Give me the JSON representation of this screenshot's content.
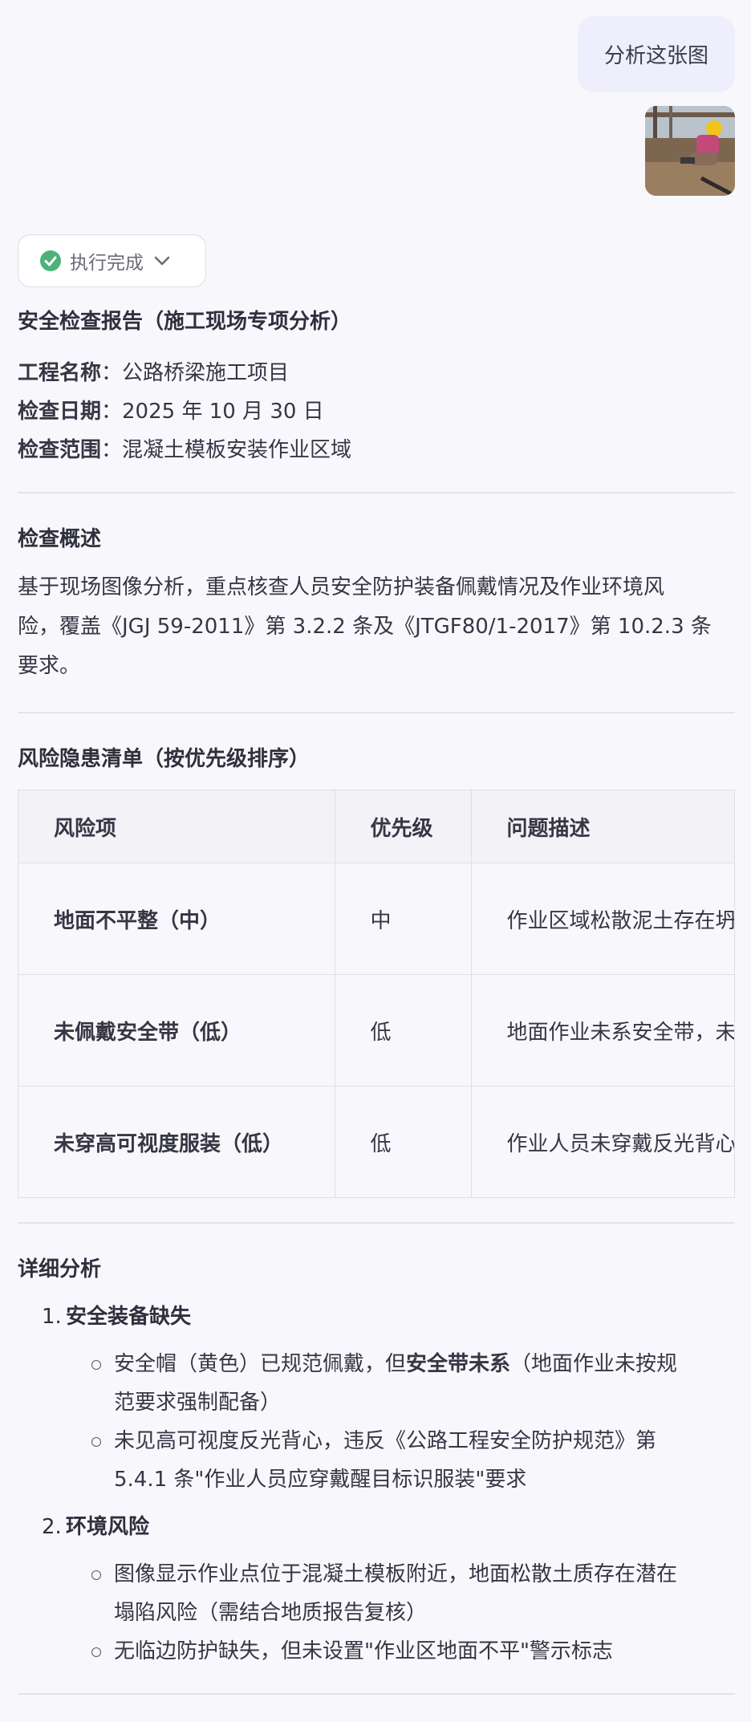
{
  "user_message": {
    "text": "分析这张图",
    "image_icon": "construction-worker-photo"
  },
  "status": {
    "label": "执行完成",
    "icon": "check-circle-icon",
    "icon_color": "#4cb27a"
  },
  "report": {
    "title": "安全检查报告（施工现场专项分析）",
    "meta": [
      {
        "key": "工程名称",
        "value": "：公路桥梁施工项目"
      },
      {
        "key": "检查日期",
        "value": "：2025 年 10 月 30 日"
      },
      {
        "key": "检查范围",
        "value": "：混凝土模板安装作业区域"
      }
    ],
    "overview": {
      "title": "检查概述",
      "lines": [
        "基于现场图像分析，重点核查人员安全防护装备佩戴情况及作业环境风",
        "险，覆盖《JGJ 59-2011》第 3.2.2 条及《JTGF80/1-2017》第 10.2.3 条",
        "要求。"
      ]
    },
    "risk_list": {
      "title": "风险隐患清单（按优先级排序）",
      "headers": [
        "风险项",
        "优先级",
        "问题描述"
      ],
      "rows": [
        {
          "item": "地面不平整（中）",
          "priority": "中",
          "desc": "作业区域松散泥土存在坍"
        },
        {
          "item": "未佩戴安全带（低）",
          "priority": "低",
          "desc": "地面作业未系安全带，未"
        },
        {
          "item": "未穿高可视度服装（低）",
          "priority": "低",
          "desc": "作业人员未穿戴反光背心"
        }
      ]
    },
    "details": {
      "title": "详细分析",
      "items": [
        {
          "num": "1.",
          "title": "安全装备缺失",
          "subs": [
            {
              "pre": "安全帽（黄色）已规范佩戴，但",
              "bold": "安全带未系",
              "post": "（地面作业未按规",
              "line2": "范要求强制配备）"
            },
            {
              "pre": "未见高可视度反光背心，违反《公路工程安全防护规范》第",
              "bold": "",
              "post": "",
              "line2": "5.4.1 条\"作业人员应穿戴醒目标识服装\"要求"
            }
          ]
        },
        {
          "num": "2.",
          "title": "环境风险",
          "subs": [
            {
              "pre": "图像显示作业点位于混凝土模板附近，地面松散土质存在潜在",
              "bold": "",
              "post": "",
              "line2": "塌陷风险（需结合地质报告复核）"
            },
            {
              "pre": "无临边防护缺失，但未设置\"作业区地面不平\"警示标志",
              "bold": "",
              "post": "",
              "line2": ""
            }
          ]
        }
      ]
    }
  }
}
